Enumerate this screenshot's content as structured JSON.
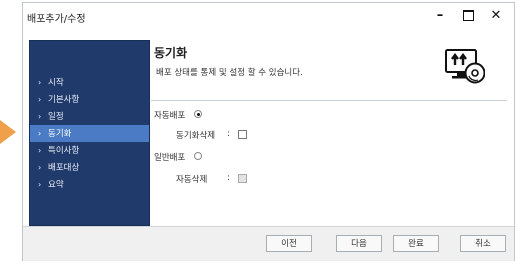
{
  "window": {
    "title": "배포추가/수정",
    "minimize": "–",
    "close": "✕"
  },
  "sidebar": {
    "items": [
      {
        "label": "시작",
        "active": false
      },
      {
        "label": "기본사항",
        "active": false
      },
      {
        "label": "일정",
        "active": false
      },
      {
        "label": "동기화",
        "active": true
      },
      {
        "label": "특이사항",
        "active": false
      },
      {
        "label": "배포대상",
        "active": false
      },
      {
        "label": "요약",
        "active": false
      }
    ],
    "chevron": "›"
  },
  "main": {
    "title": "동기화",
    "description": "배포 상태를 통제 및 설정 할 수 있습니다.",
    "icon": "sync-deploy-icon",
    "auto_deploy": {
      "label": "자동배포",
      "selected": true
    },
    "sync_delete": {
      "label": "동기화삭제",
      "separator": ":",
      "checked": false
    },
    "general_deploy": {
      "label": "일반배포",
      "selected": false
    },
    "auto_delete": {
      "label": "자동삭제",
      "separator": ":",
      "checked": false,
      "disabled": true
    }
  },
  "footer": {
    "prev": "이전",
    "next": "다음",
    "finish": "완료",
    "cancel": "취소"
  },
  "colors": {
    "sidebar_bg": "#1f3a6b",
    "sidebar_active": "#4a7bc4",
    "accent_arrow": "#f0a04b"
  }
}
